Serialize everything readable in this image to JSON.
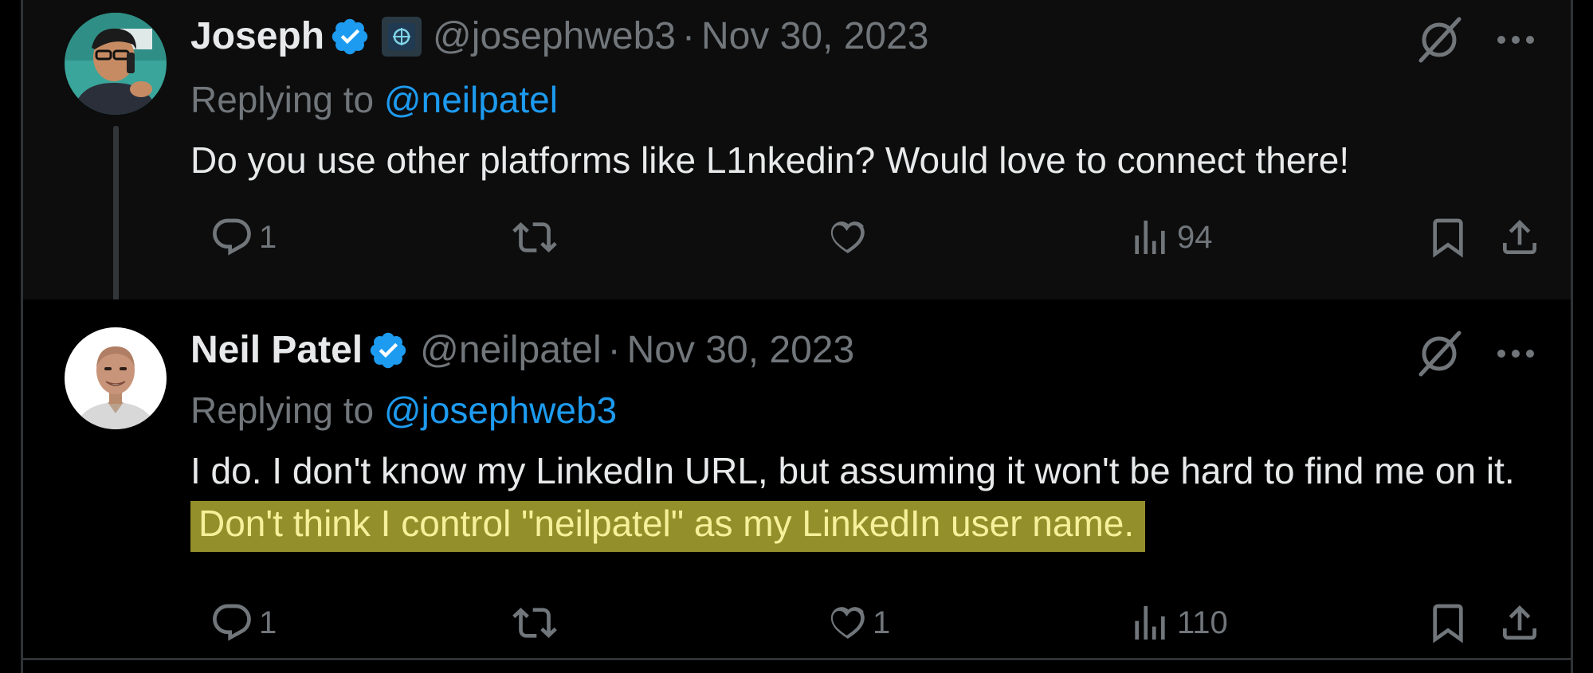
{
  "tweets": [
    {
      "name": "Joseph",
      "handle": "@josephweb3",
      "separator": "·",
      "date": "Nov 30, 2023",
      "replying_prefix": "Replying to",
      "replying_to": "@neilpatel",
      "text": "Do you use other platforms like L1nkedin? Would love to connect there!",
      "replies": "1",
      "retweets": "",
      "likes": "",
      "views": "94"
    },
    {
      "name": "Neil Patel",
      "handle": "@neilpatel",
      "separator": "·",
      "date": "Nov 30, 2023",
      "replying_prefix": "Replying to",
      "replying_to": "@josephweb3",
      "text_plain": "I do. I don't know my LinkedIn URL, but assuming it won't be hard to find me on it.",
      "text_highlight": "Don't think I control \"neilpatel\" as my LinkedIn user name.",
      "replies": "1",
      "retweets": "",
      "likes": "1",
      "views": "110"
    }
  ],
  "colors": {
    "verified": "#1d9bf0",
    "link": "#1d9bf0",
    "muted": "#71767b",
    "highlight_bg": "#938f2a",
    "highlight_text": "#f5f19a"
  },
  "icons": [
    "verified-badge-icon",
    "affiliate-badge-icon",
    "grok-icon",
    "more-icon",
    "reply-icon",
    "retweet-icon",
    "like-icon",
    "views-icon",
    "bookmark-icon",
    "share-icon"
  ]
}
